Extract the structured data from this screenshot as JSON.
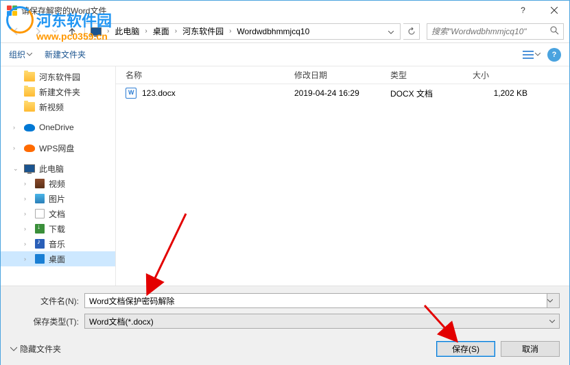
{
  "title": "请保存解密的Word文件",
  "watermark": {
    "brand": "河东软件园",
    "url": "www.pc0359.cn"
  },
  "breadcrumb": {
    "segs": [
      "此电脑",
      "桌面",
      "河东软件园",
      "Wordwdbhmmjcq10"
    ]
  },
  "search": {
    "placeholder": "搜索\"Wordwdbhmmjcq10\""
  },
  "toolbar": {
    "organize": "组织",
    "newfolder": "新建文件夹"
  },
  "sidebar": {
    "items": [
      {
        "label": "河东软件园",
        "type": "folder"
      },
      {
        "label": "新建文件夹",
        "type": "folder"
      },
      {
        "label": "新视频",
        "type": "folder"
      },
      {
        "label": "OneDrive",
        "type": "onedrive"
      },
      {
        "label": "WPS网盘",
        "type": "wps"
      },
      {
        "label": "此电脑",
        "type": "pc"
      },
      {
        "label": "视频",
        "type": "sub"
      },
      {
        "label": "图片",
        "type": "sub"
      },
      {
        "label": "文档",
        "type": "sub"
      },
      {
        "label": "下载",
        "type": "sub"
      },
      {
        "label": "音乐",
        "type": "sub"
      },
      {
        "label": "桌面",
        "type": "sub",
        "selected": true
      }
    ]
  },
  "list": {
    "headers": {
      "name": "名称",
      "date": "修改日期",
      "type": "类型",
      "size": "大小"
    },
    "rows": [
      {
        "name": "123.docx",
        "date": "2019-04-24 16:29",
        "type": "DOCX 文档",
        "size": "1,202 KB"
      }
    ]
  },
  "form": {
    "filename_label": "文件名(N):",
    "filename_value": "Word文档保护密码解除",
    "filetype_label": "保存类型(T):",
    "filetype_value": "Word文档(*.docx)"
  },
  "footer": {
    "hide_folders": "隐藏文件夹",
    "save": "保存(S)",
    "cancel": "取消"
  }
}
